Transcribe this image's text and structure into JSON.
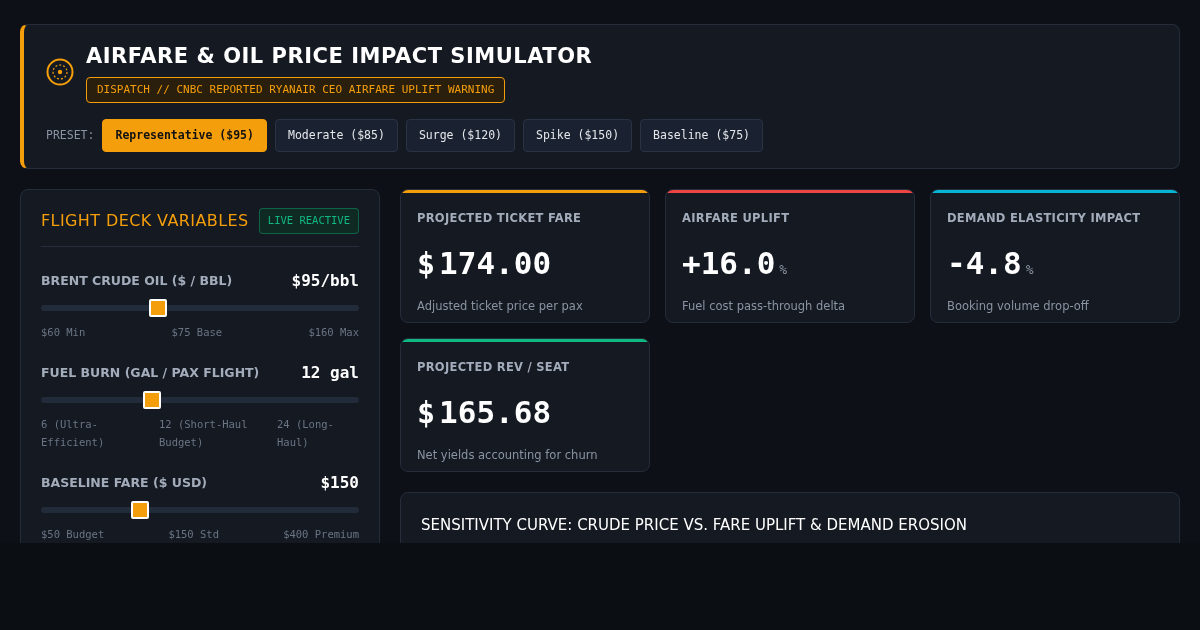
{
  "header": {
    "title": "AIRFARE & OIL PRICE IMPACT SIMULATOR",
    "dispatch": "DISPATCH // CNBC REPORTED RYANAIR CEO AIRFARE UPLIFT WARNING",
    "preset_label": "PRESET:",
    "presets": [
      {
        "label": "Representative ($95)",
        "selected": true
      },
      {
        "label": "Moderate ($85)",
        "selected": false
      },
      {
        "label": "Surge ($120)",
        "selected": false
      },
      {
        "label": "Spike ($150)",
        "selected": false
      },
      {
        "label": "Baseline ($75)",
        "selected": false
      }
    ]
  },
  "variables": {
    "title": "FLIGHT DECK VARIABLES",
    "badge": "LIVE REACTIVE",
    "sliders": [
      {
        "label": "BRENT CRUDE OIL ($ / BBL)",
        "reading": "$95/bbl",
        "level": 0.36,
        "ticks": [
          "$60 Min",
          "$75 Base",
          "$160 Max"
        ]
      },
      {
        "label": "FUEL BURN (GAL / PAX FLIGHT)",
        "reading": "12 gal",
        "level": 0.34,
        "ticks": [
          "6 (Ultra-Efficient)",
          "12 (Short-Haul Budget)",
          "24 (Long-Haul)"
        ]
      },
      {
        "label": "BASELINE FARE ($ USD)",
        "reading": "$150",
        "level": 0.3,
        "ticks": [
          "$50 Budget",
          "$150 Std",
          "$400 Premium"
        ]
      }
    ]
  },
  "metrics": [
    {
      "label": "PROJECTED TICKET FARE",
      "prefix": "$",
      "value": "174.00",
      "note": "Adjusted ticket price per pax",
      "color": "#f59e0b"
    },
    {
      "label": "AIRFARE UPLIFT",
      "value": "+16.0",
      "suffix": "%",
      "note": "Fuel cost pass-through delta",
      "color": "#ef4444"
    },
    {
      "label": "DEMAND ELASTICITY IMPACT",
      "value": "-4.8",
      "suffix": "%",
      "note": "Booking volume drop-off",
      "color": "#06b6d4"
    },
    {
      "label": "PROJECTED REV / SEAT",
      "prefix": "$",
      "value": "165.68",
      "note": "Net yields accounting for churn",
      "color": "#10b981"
    }
  ],
  "chart_panel": {
    "title": "SENSITIVITY CURVE: CRUDE PRICE VS. FARE UPLIFT & DEMAND EROSION"
  }
}
